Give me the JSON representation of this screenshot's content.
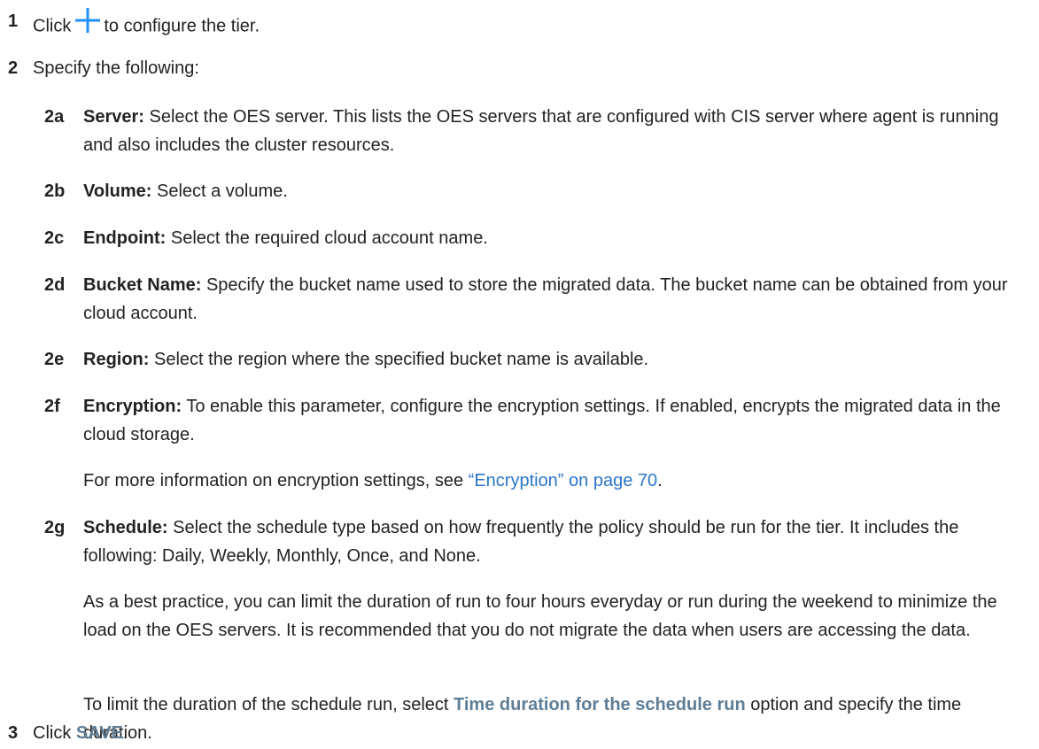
{
  "steps": [
    {
      "num": "1",
      "pre": "Click",
      "post": "to configure the tier."
    },
    {
      "num": "2",
      "text": "Specify the following:"
    },
    {
      "num": "3",
      "pre": "Click",
      "ui": "SAVE",
      "post": "."
    }
  ],
  "substeps": {
    "server": {
      "num": "2a",
      "label": "Server:",
      "text": " Select the OES server. This lists the OES servers that are configured with CIS server where agent is running and also includes the cluster resources."
    },
    "volume": {
      "num": "2b",
      "label": "Volume:",
      "text": " Select a volume."
    },
    "endpoint": {
      "num": "2c",
      "label": "Endpoint:",
      "text": " Select the required cloud account name."
    },
    "bucket": {
      "num": "2d",
      "label": "Bucket Name:",
      "text": " Specify the bucket name used to store the migrated data. The bucket name can be obtained from your cloud account."
    },
    "region": {
      "num": "2e",
      "label": "Region:",
      "text": " Select the region where the specified bucket name is available."
    },
    "encryption": {
      "num": "2f",
      "label": "Encryption:",
      "text": " To enable this parameter, configure the encryption settings. If enabled, encrypts the migrated data in the cloud storage."
    },
    "schedule": {
      "num": "2g",
      "label": "Schedule:",
      "text": " Select the schedule type based on how frequently the policy should be run for the tier. It includes the following: Daily, Weekly, Monthly, Once, and None."
    }
  },
  "paragraphs": {
    "encryption_more_pre": "For more information on encryption settings, see ",
    "encryption_link": "“Encryption” on page 70",
    "encryption_more_post": ".",
    "best_practice": "As a best practice, you can limit the duration of run to four hours everyday or run during the weekend to minimize the load on the OES servers. It is recommended that you do not migrate the data when users are accessing the data.",
    "duration_pre": "To limit the duration of the schedule run, select ",
    "duration_ui": "Time duration for the schedule run",
    "duration_post": " option and specify the time duration."
  },
  "icons": {
    "plus": "plus-icon",
    "plus_color": "#1e90ff"
  }
}
